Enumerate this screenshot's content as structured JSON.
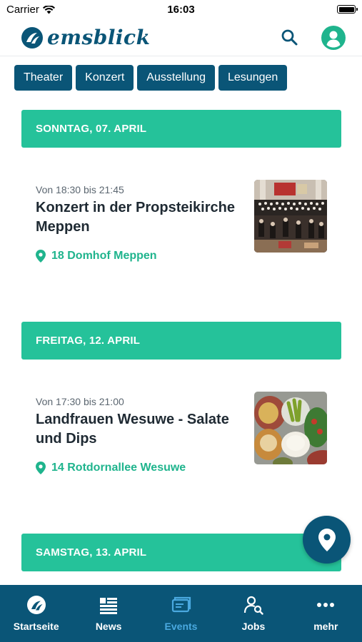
{
  "status_bar": {
    "carrier": "Carrier",
    "time": "16:03"
  },
  "header": {
    "app_name": "emsblick"
  },
  "categories": [
    "Theater",
    "Konzert",
    "Ausstellung",
    "Lesungen"
  ],
  "days": [
    {
      "date_label": "SONNTAG, 07. APRIL",
      "events": [
        {
          "time": "Von  18:30 bis 21:45",
          "title": "Konzert in der Propsteikirche Meppen",
          "location": "18 Domhof Meppen",
          "image": "concert-choir-photo"
        }
      ]
    },
    {
      "date_label": "FREITAG, 12. APRIL",
      "events": [
        {
          "time": "Von  17:30 bis 21:00",
          "title": "Landfrauen Wesuwe - Salate und Dips",
          "location": "14 Rotdornallee Wesuwe",
          "image": "salad-dips-photo"
        }
      ]
    },
    {
      "date_label": "SAMSTAG, 13. APRIL",
      "events": []
    }
  ],
  "tab_bar": {
    "active": "Events",
    "items": [
      {
        "label": "Startseite",
        "icon": "emsblick-logo-icon"
      },
      {
        "label": "News",
        "icon": "news-icon"
      },
      {
        "label": "Events",
        "icon": "events-icon"
      },
      {
        "label": "Jobs",
        "icon": "jobs-icon"
      },
      {
        "label": "mehr",
        "icon": "more-icon"
      }
    ]
  },
  "colors": {
    "primary": "#0a5577",
    "accent": "#25c29a",
    "active_tab": "#4aa9e0"
  }
}
